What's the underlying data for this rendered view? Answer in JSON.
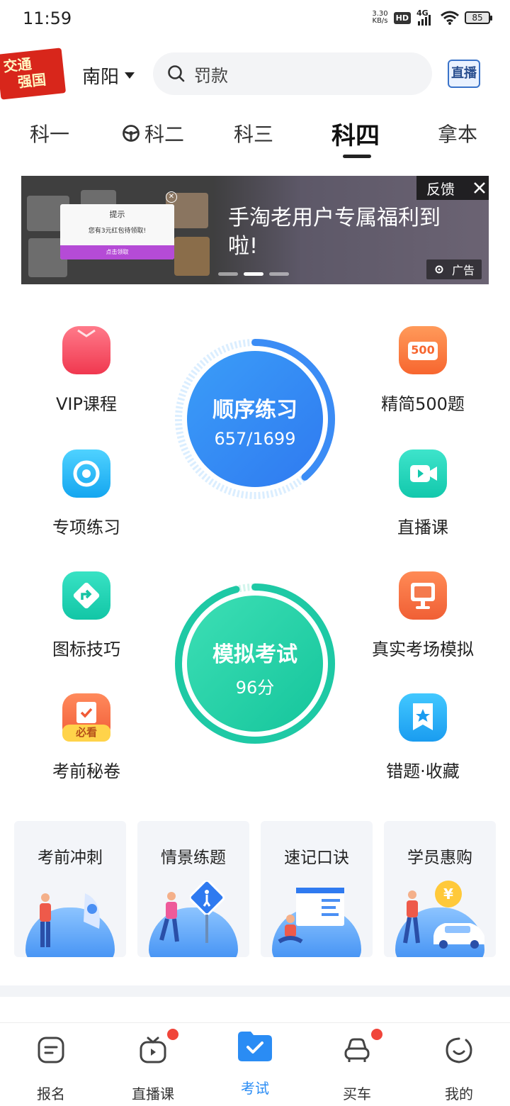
{
  "status_bar": {
    "time": "11:59",
    "net_speed_value": "3.30",
    "net_speed_unit": "KB/s",
    "hd": "HD",
    "network": "4G",
    "battery": "85"
  },
  "header": {
    "logo_line1": "交通",
    "logo_line2": "强国",
    "city": "南阳",
    "search_placeholder": "罚款",
    "live_button": "直播"
  },
  "tabs": [
    {
      "label": "科一"
    },
    {
      "label": "科二"
    },
    {
      "label": "科三"
    },
    {
      "label": "科四",
      "active": true
    },
    {
      "label": "拿本"
    }
  ],
  "banner": {
    "headline": "手淘老用户专属福利到啦!",
    "feedback": "反馈",
    "ad_label": "广告",
    "popup_title": "提示",
    "popup_body": "您有3元红包待领取!",
    "popup_button": "点击领取",
    "active_slide": 2,
    "slide_count": 3
  },
  "features_left": [
    {
      "label": "VIP课程",
      "icon": "vip-course-icon"
    },
    {
      "label": "专项练习",
      "icon": "target-icon"
    },
    {
      "label": "图标技巧",
      "icon": "sign-arrow-icon"
    },
    {
      "label": "考前秘卷",
      "icon": "must-read-icon",
      "badge": "必看"
    }
  ],
  "features_right": [
    {
      "label": "精简500题",
      "icon": "500-questions-icon",
      "badge": "500"
    },
    {
      "label": "直播课",
      "icon": "video-icon"
    },
    {
      "label": "真实考场模拟",
      "icon": "monitor-icon"
    },
    {
      "label": "错题·收藏",
      "icon": "bookmark-star-icon"
    }
  ],
  "practice_circle": {
    "title": "顺序练习",
    "progress": "657/1699",
    "done": 657,
    "total": 1699,
    "color": "#3b8cf5"
  },
  "exam_circle": {
    "title": "模拟考试",
    "score": "96分",
    "score_value": 96,
    "color": "#1ec9a5"
  },
  "cards": [
    {
      "title": "考前冲刺"
    },
    {
      "title": "情景练题"
    },
    {
      "title": "速记口诀"
    },
    {
      "title": "学员惠购"
    }
  ],
  "bottom_nav": [
    {
      "label": "报名",
      "icon": "form-icon"
    },
    {
      "label": "直播课",
      "icon": "tv-icon",
      "dot": true
    },
    {
      "label": "考试",
      "icon": "exam-folder-icon",
      "active": true
    },
    {
      "label": "买车",
      "icon": "car-icon",
      "dot": true
    },
    {
      "label": "我的",
      "icon": "smile-face-icon"
    }
  ]
}
